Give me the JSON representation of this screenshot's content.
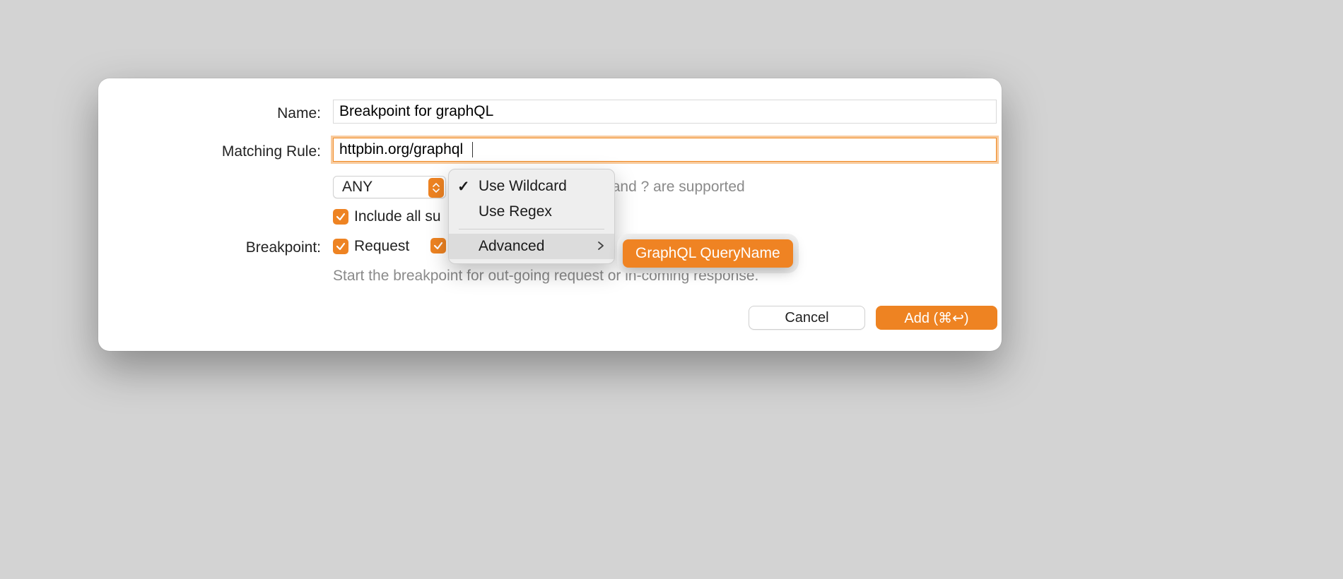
{
  "labels": {
    "name": "Name:",
    "matching_rule": "Matching Rule:",
    "breakpoint": "Breakpoint:"
  },
  "fields": {
    "name_value": "Breakpoint for graphQL",
    "rule_value": "httpbin.org/graphql",
    "method_value": "ANY"
  },
  "hints": {
    "wildcard_tail": "ple wildcard * and ? are supported",
    "breakpoint_help": "Start the breakpoint for out-going request or in-coming response."
  },
  "checkboxes": {
    "include_subpaths_partial": "Include all su",
    "request": "Request"
  },
  "menu": {
    "use_wildcard": "Use Wildcard",
    "use_regex": "Use Regex",
    "advanced": "Advanced",
    "submenu_graphql": "GraphQL QueryName"
  },
  "buttons": {
    "cancel": "Cancel",
    "add": "Add (⌘↩︎)"
  }
}
